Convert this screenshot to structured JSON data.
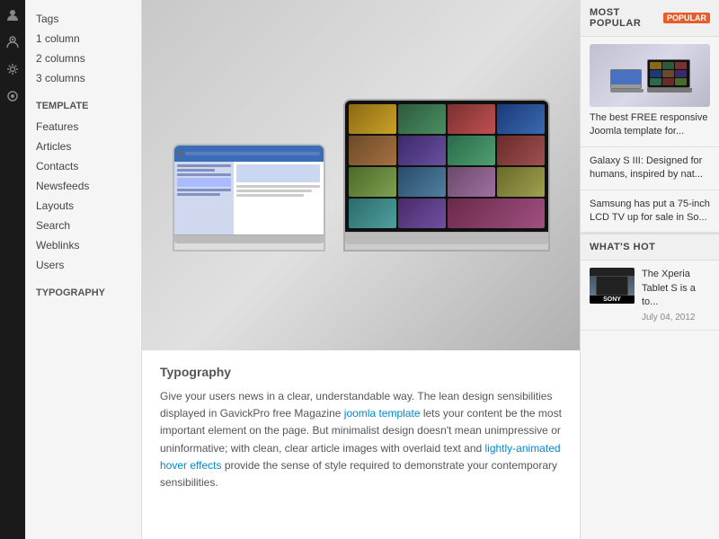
{
  "iconSidebar": {
    "icons": [
      {
        "name": "person-icon",
        "glyph": "👤"
      },
      {
        "name": "person2-icon",
        "glyph": "⊙"
      },
      {
        "name": "settings-icon",
        "glyph": "⚙"
      },
      {
        "name": "circle-icon",
        "glyph": "◎"
      }
    ]
  },
  "navSidebar": {
    "sections": [
      {
        "title": "",
        "items": [
          {
            "label": "Tags",
            "href": "#"
          },
          {
            "label": "1 column",
            "href": "#"
          },
          {
            "label": "2 columns",
            "href": "#"
          },
          {
            "label": "3 columns",
            "href": "#"
          }
        ]
      },
      {
        "title": "Template",
        "items": [
          {
            "label": "Features",
            "href": "#"
          },
          {
            "label": "Articles",
            "href": "#"
          },
          {
            "label": "Contacts",
            "href": "#"
          },
          {
            "label": "Newsfeeds",
            "href": "#"
          },
          {
            "label": "Layouts",
            "href": "#"
          },
          {
            "label": "Search",
            "href": "#"
          },
          {
            "label": "Weblinks",
            "href": "#"
          },
          {
            "label": "Users",
            "href": "#"
          }
        ]
      },
      {
        "title": "Typography",
        "items": []
      }
    ]
  },
  "main": {
    "heroAlt": "Two laptops showing responsive design",
    "typographyTitle": "Typography",
    "bodyText1": "Give your users news in a clear, understandable way. The lean design sensibilities displayed in GavickPro free Magazine ",
    "bodyLink1": "joomla template",
    "bodyLink1Href": "#",
    "bodyText2": " lets your content be the most important element on the page. But minimalist design doesn't mean unimpressive or uninformative; with clean, clear article images with overlaid text and ",
    "bodyLink2": "lightly-animated hover effects",
    "bodyLink2Href": "#",
    "bodyText3": " provide the sense of style required to demonstrate your contemporary sensibilities."
  },
  "rightSidebar": {
    "mostPopular": {
      "title": "MOST POPULAR",
      "badge": "POPULAR",
      "cards": [
        {
          "title": "The best FREE responsive Joomla template for...",
          "href": "#"
        },
        {
          "title": "Galaxy S III: Designed for humans, inspired by nat...",
          "href": "#"
        },
        {
          "title": "Samsung has put a 75-inch LCD TV up for sale in So...",
          "href": "#"
        }
      ]
    },
    "whatsHot": {
      "title": "WHAT'S HOT",
      "cards": [
        {
          "title": "The Xperia Tablet S is a to...",
          "date": "July 04, 2012",
          "brand": "SONY"
        }
      ]
    }
  }
}
